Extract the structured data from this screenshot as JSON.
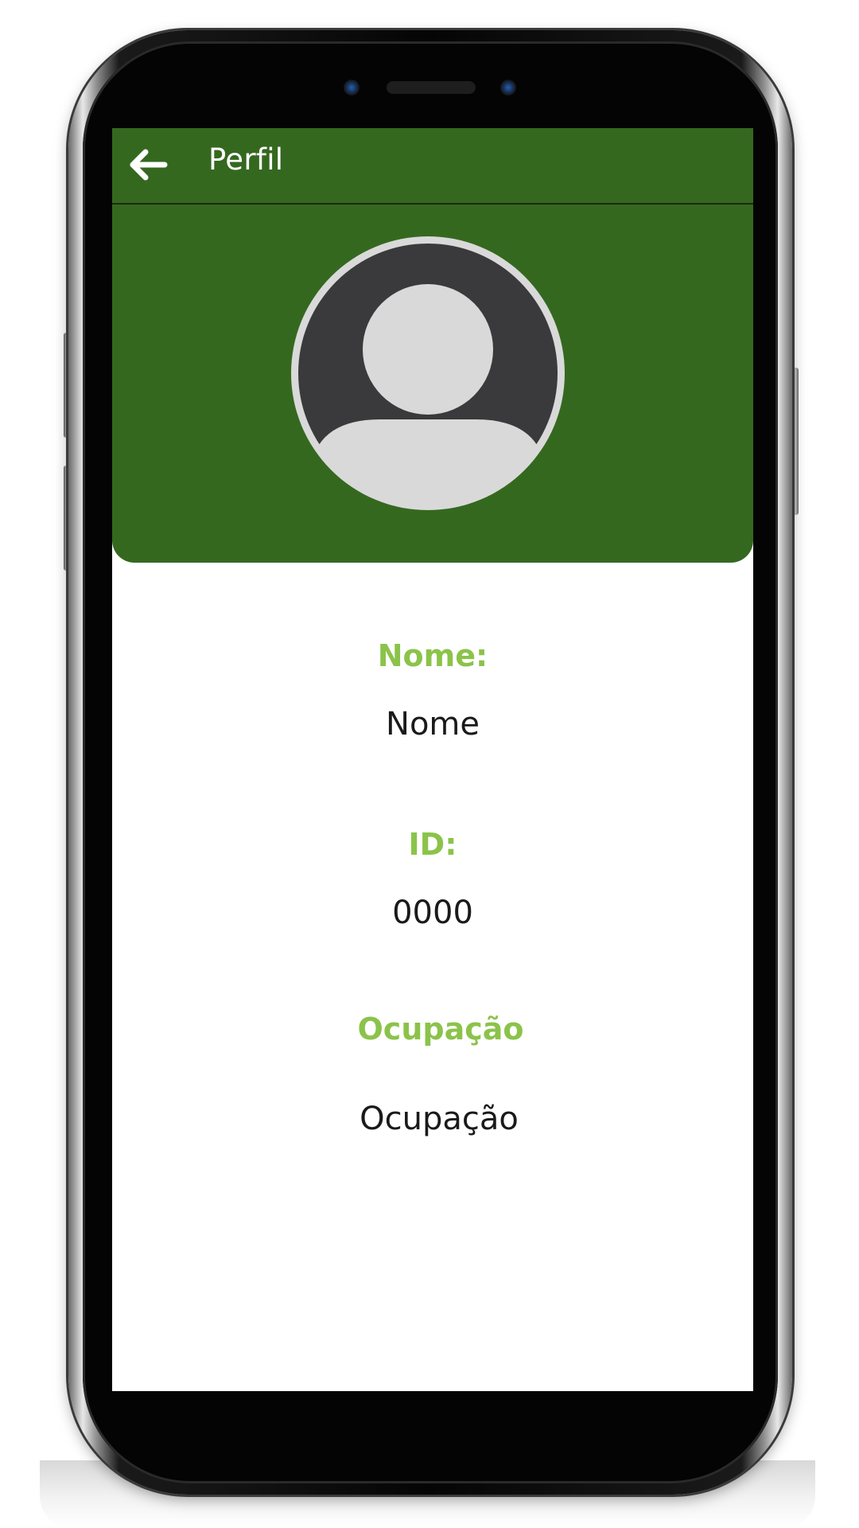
{
  "appbar": {
    "title": "Perfil",
    "back_icon": "arrow-left-icon"
  },
  "profile": {
    "avatar_icon": "user-avatar-icon",
    "fields": [
      {
        "label": "Nome:",
        "value": "Nome"
      },
      {
        "label": "ID:",
        "value": "0000"
      },
      {
        "label": "Ocupação",
        "value": "Ocupação"
      }
    ]
  },
  "colors": {
    "primary": "#35681f",
    "accent": "#8bc34a",
    "avatar_dark": "#3a3a3c",
    "avatar_light": "#d9d9d9"
  }
}
